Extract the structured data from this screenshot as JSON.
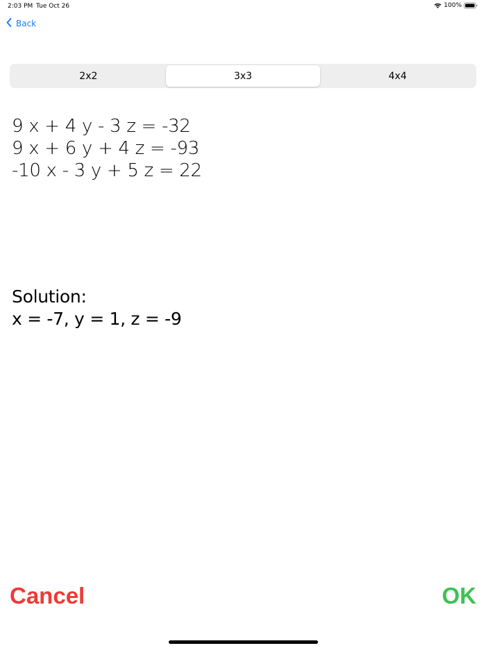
{
  "status_bar": {
    "time": "2:03 PM",
    "date": "Tue Oct 26",
    "battery": "100%",
    "wifi_icon": "wifi-icon",
    "battery_icon": "battery-icon"
  },
  "nav": {
    "back_label": "Back",
    "back_icon": "chevron-left-icon"
  },
  "segments": [
    {
      "label": "2x2",
      "selected": false
    },
    {
      "label": "3x3",
      "selected": true
    },
    {
      "label": "4x4",
      "selected": false
    }
  ],
  "equations": [
    "9 x + 4 y - 3 z = -32",
    "9 x + 6 y + 4 z = -93",
    "-10 x - 3 y + 5 z = 22"
  ],
  "solution": {
    "heading": "Solution:",
    "value": "x = -7, y = 1, z = -9"
  },
  "actions": {
    "cancel_label": "Cancel",
    "ok_label": "OK"
  },
  "colors": {
    "accent_blue": "#1a7cf5",
    "cancel_red": "#ee3a36",
    "ok_green": "#3ec253",
    "segment_bg": "#eeeeef"
  }
}
